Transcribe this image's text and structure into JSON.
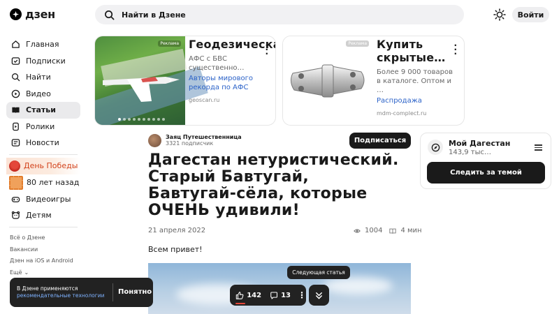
{
  "header": {
    "logo": "дзен",
    "search_placeholder": "Найти в Дзене",
    "login_label": "Войти"
  },
  "sidebar": {
    "nav": [
      {
        "label": "Главная",
        "icon": "home-icon"
      },
      {
        "label": "Подписки",
        "icon": "subscriptions-icon"
      },
      {
        "label": "Найти",
        "icon": "search-icon"
      },
      {
        "label": "Видео",
        "icon": "video-icon"
      },
      {
        "label": "Статьи",
        "icon": "articles-icon",
        "active": true
      },
      {
        "label": "Ролики",
        "icon": "shorts-icon"
      },
      {
        "label": "Новости",
        "icon": "news-icon"
      }
    ],
    "promos": [
      {
        "label": "День Победы",
        "icon": "carnation-icon"
      },
      {
        "label": "80 лет назад",
        "icon": "stamp-icon"
      },
      {
        "label": "Видеоигры",
        "icon": "gamepad-icon"
      },
      {
        "label": "Детям",
        "icon": "kids-icon"
      }
    ],
    "footer_links": [
      "Всё о Дзене",
      "Вакансии",
      "Дзен на iOS и Android",
      "Ещё"
    ]
  },
  "ads": [
    {
      "label": "Реклама",
      "title": "Геодезическая…",
      "description": "АФС с БВС существенно…",
      "link": "Авторы мирового рекорда по АФС",
      "domain": "geoscan.ru"
    },
    {
      "label": "Реклама",
      "title": "Купить скрытые…",
      "description": "Более 9 000 товаров в каталоге. Оптом и …",
      "link": "Распродажа",
      "domain": "mdm-complect.ru"
    }
  ],
  "article": {
    "author_name": "Заяц Путешественница",
    "author_subscribers": "3321 подписчик",
    "subscribe_label": "Подписаться",
    "title": "Дагестан нетуристический. Старый Бавтугай, Бавтугай-сёла, которые ОЧЕНЬ удивили!",
    "date": "21 апреля 2022",
    "views": "1004",
    "read_time": "4 мин",
    "greeting": "Всем привет!"
  },
  "topic": {
    "name": "Мой Дагестан",
    "count": "143,9 тыс…",
    "follow_label": "Следить за темой"
  },
  "cookie": {
    "text": "В Дзене применяются",
    "link": "рекомендательные технологии",
    "ok_label": "Понятно"
  },
  "controls": {
    "tooltip": "Следующая статья",
    "likes": "142",
    "comments": "13"
  }
}
